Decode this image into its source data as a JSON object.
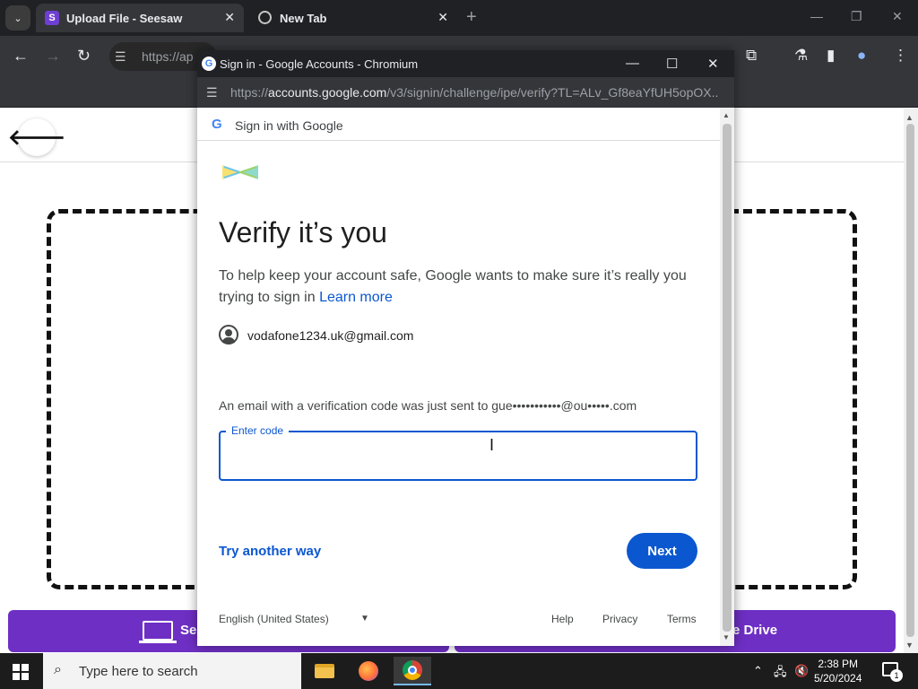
{
  "browser": {
    "tabs": [
      {
        "title": "Upload File - Seesaw",
        "favicon": "S"
      },
      {
        "title": "New Tab"
      }
    ],
    "new_tab": "+",
    "omnibox_text": "https://ap"
  },
  "background_page": {
    "select_button_label": "Sel",
    "drive_button_label": "e Drive",
    "accent_color": "#6e2fc4"
  },
  "popup": {
    "window_title": "Sign in - Google Accounts - Chromium",
    "url_host": "accounts.google.com",
    "url_path": "/v3/signin/challenge/ipe/verify?TL=ALv_Gf8eaYfUH5opOX...",
    "url_scheme": "https://",
    "header_g": "G",
    "header_text": "Sign in with Google",
    "title": "Verify it’s you",
    "description": "To help keep your account safe, Google wants to make sure it’s really you trying to sign in",
    "learn_more": "Learn more",
    "account_email": "vodafone1234.uk@gmail.com",
    "sent_message": "An email with a verification code was just sent to gue•••••••••••@ou•••••.com",
    "code_label": "Enter code",
    "code_value": "",
    "try_another": "Try another way",
    "next": "Next",
    "language": "English (United States)",
    "footer": {
      "help": "Help",
      "privacy": "Privacy",
      "terms": "Terms"
    },
    "primary_color": "#0b57d0"
  },
  "taskbar": {
    "search_placeholder": "Type here to search",
    "time": "2:38 PM",
    "date": "5/20/2024",
    "notification_count": "1"
  }
}
